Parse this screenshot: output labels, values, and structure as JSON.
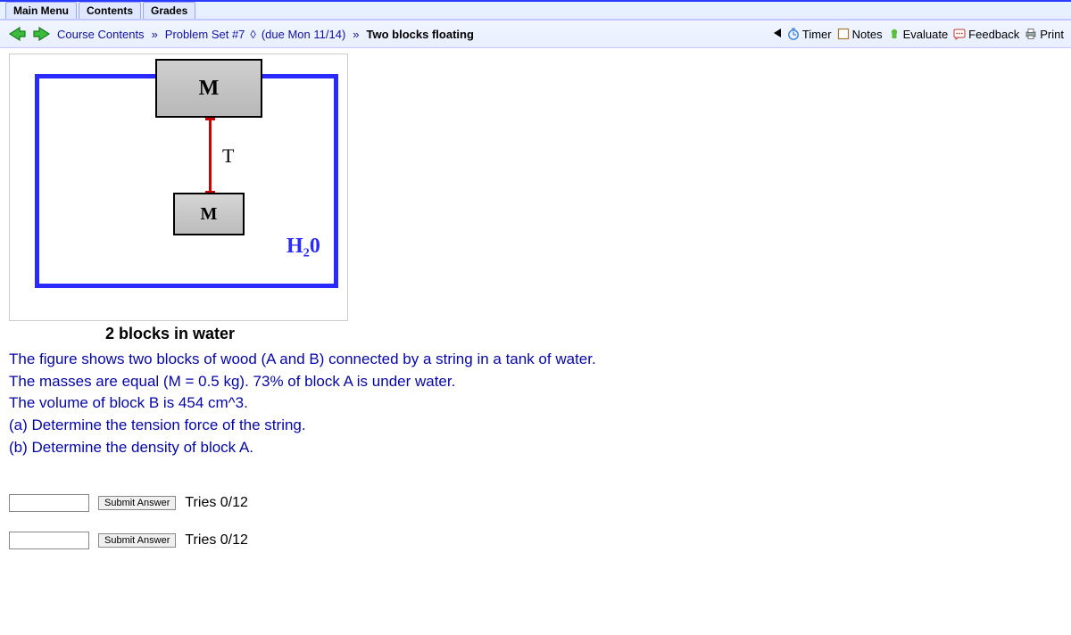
{
  "tabs": {
    "main_menu": "Main Menu",
    "contents": "Contents",
    "grades": "Grades"
  },
  "breadcrumb": {
    "course_contents": "Course Contents",
    "problem_set": "Problem Set #7",
    "due": "(due Mon 11/14)",
    "current": "Two blocks floating",
    "sep": "»",
    "diamond": "◊"
  },
  "toolbar": {
    "timer": "Timer",
    "notes": "Notes",
    "evaluate": "Evaluate",
    "feedback": "Feedback",
    "print": "Print"
  },
  "diagram": {
    "block_a_label": "M",
    "block_b_label": "M",
    "tension_label": "T",
    "water_label": "H₂0",
    "caption": "2 blocks in water"
  },
  "problem": {
    "line1": "The figure shows two blocks of wood (A and B) connected by a string in a tank of water.",
    "line2": "The masses are equal (M = 0.5 kg). 73% of block A is under water.",
    "line3": "The volume of block B is 454 cm^3.",
    "line4": "(a) Determine the tension force of the string.",
    "line5": "(b) Determine the density of block A."
  },
  "answers": {
    "submit_label": "Submit Answer",
    "tries_a": "Tries 0/12",
    "tries_b": "Tries 0/12"
  }
}
